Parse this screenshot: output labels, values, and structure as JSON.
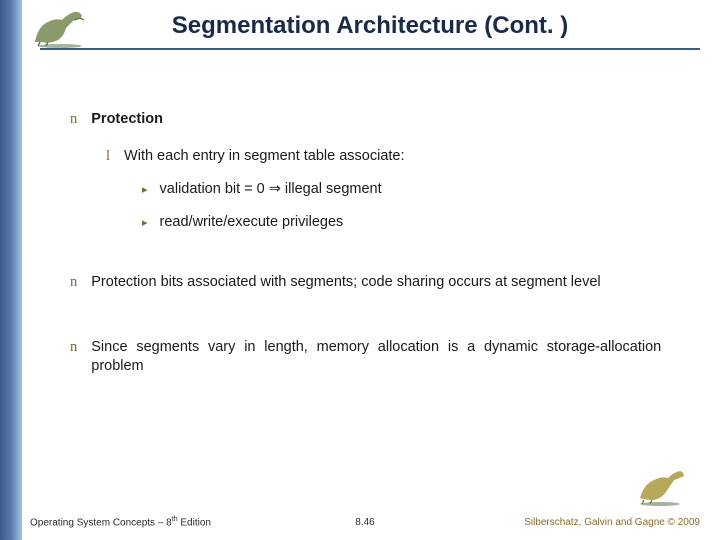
{
  "title": "Segmentation Architecture (Cont. )",
  "bullets": {
    "b1": {
      "marker": "n",
      "text": "Protection"
    },
    "b2": {
      "marker": "l",
      "text": "With each entry in segment table associate:"
    },
    "b3a": {
      "marker": "▸",
      "text": "validation bit = 0 ⇒ illegal segment"
    },
    "b3b": {
      "marker": "▸",
      "text": "read/write/execute privileges"
    },
    "b1b": {
      "marker": "n",
      "text": "Protection bits associated with segments; code sharing occurs at segment level"
    },
    "b1c": {
      "marker": "n",
      "text": "Since segments vary in length, memory allocation is a dynamic storage-allocation problem"
    }
  },
  "footer": {
    "left_prefix": "Operating System Concepts – 8",
    "left_sup": "th",
    "left_suffix": " Edition",
    "mid": "8.46",
    "right": "Silberschatz, Galvin and Gagne © 2009"
  },
  "icons": {
    "dino_tl": "dinosaur-icon",
    "dino_br": "dinosaur-icon"
  }
}
